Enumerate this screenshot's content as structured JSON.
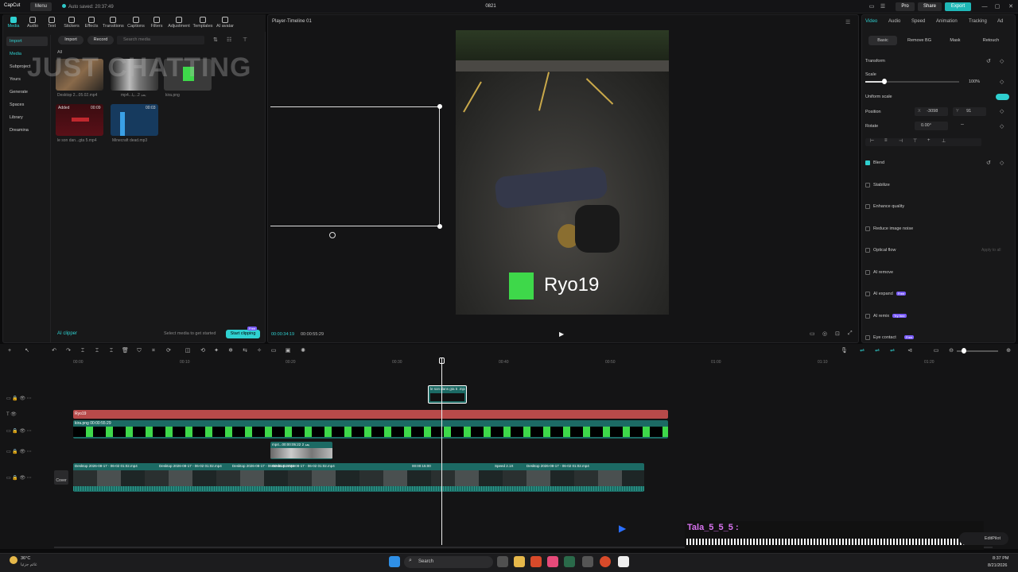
{
  "app": {
    "logo": "CapCut",
    "menu": "Menu",
    "autosave": "Auto saved: 20:37:49",
    "project": "0821",
    "pro": "Pro",
    "share": "Share",
    "export": "Export"
  },
  "top_tools": [
    "Media",
    "Audio",
    "Text",
    "Stickers",
    "Effects",
    "Transitions",
    "Captions",
    "Filters",
    "Adjustment",
    "Templates",
    "AI avatar"
  ],
  "sidebar": [
    {
      "label": "Import"
    },
    {
      "label": "Media"
    },
    {
      "label": "Subproject"
    },
    {
      "label": "Yours"
    },
    {
      "label": "Generate"
    },
    {
      "label": "Spaces"
    },
    {
      "label": "Library"
    },
    {
      "label": "Dreamina"
    }
  ],
  "media_bar": {
    "import": "Import",
    "record": "Record",
    "search": "Search media",
    "filter": "All"
  },
  "media_items": [
    {
      "name": "Desktop 2...05.02.mp4"
    },
    {
      "name": "mp4...بعد 2...يا"
    },
    {
      "name": "kira.png"
    },
    {
      "name": "le son dan...gta 5.mp4",
      "badge": "Added",
      "duration": "00:09"
    },
    {
      "name": "Minecraft dead.mp3",
      "duration": "00:03"
    }
  ],
  "overlay_text": "JUST CHATTING",
  "media_footer": {
    "ai_clipper": "AI clipper",
    "hint": "Select media to get started",
    "start": "Start clipping",
    "badge": "Free"
  },
  "player": {
    "title": "Player-Timeline 01",
    "current": "00:00:34:19",
    "total": "00:00:55:29",
    "brand_name": "Ryo19"
  },
  "inspector": {
    "tabs": [
      "Video",
      "Audio",
      "Speed",
      "Animation",
      "Tracking",
      "Ad"
    ],
    "subtabs": [
      "Basic",
      "Remove BG",
      "Mask",
      "Retouch"
    ],
    "transform": "Transform",
    "scale_label": "Scale",
    "scale_value": "100%",
    "uniform_scale": "Uniform scale",
    "position_label": "Position",
    "pos_x": "-3098",
    "pos_y": "91",
    "x_label": "X",
    "y_label": "Y",
    "rotate_label": "Rotate",
    "rotate_value": "0.00°",
    "blend": "Blend",
    "options": [
      {
        "label": "Stabilize"
      },
      {
        "label": "Enhance quality"
      },
      {
        "label": "Reduce image noise"
      },
      {
        "label": "Optical flow",
        "extra": "Apply to all"
      },
      {
        "label": "AI remove"
      },
      {
        "label": "AI expand",
        "badge": "Free"
      },
      {
        "label": "AI remix",
        "badge": "Try free"
      },
      {
        "label": "Eye contact",
        "badge": "Free"
      }
    ]
  },
  "timeline": {
    "ruler": [
      "00:00",
      "00:10",
      "00:20",
      "00:30",
      "00:40",
      "00:50",
      "01:00",
      "01:10",
      "01:20"
    ],
    "clips": {
      "top": "le son dans gta 5 .mp4",
      "red": "Ryo19",
      "green_label": "kira.png",
      "green_dur": "00:00:55:29",
      "small_label": "mp4...بعد 2",
      "small_dur": "00:00:05:22",
      "main": [
        "Desktop 2026-08-17 - 06-02 01:02.mp4",
        "Desktop 2026-08-17 - 06-02 01:02.mp4",
        "Desktop 2026-08-17 - 06-02 01:02.mp4",
        "Desktop 2026-08-17 - 06-02 01:02.mp4",
        "Desktop 2026-08-17 - 06-02 01:02.mp4"
      ],
      "main_dur": "00:00:15:00",
      "speed": "Speed 2.1X",
      "cover": "Cover"
    }
  },
  "chat": {
    "name": "Tala_5_5_5 :",
    "editpilot": "EditPilot"
  },
  "taskbar": {
    "weather": "36°C",
    "weather_sub": "غائم جزئيا",
    "search": "Search",
    "time": "8:37 PM",
    "date": "8/21/2026"
  }
}
